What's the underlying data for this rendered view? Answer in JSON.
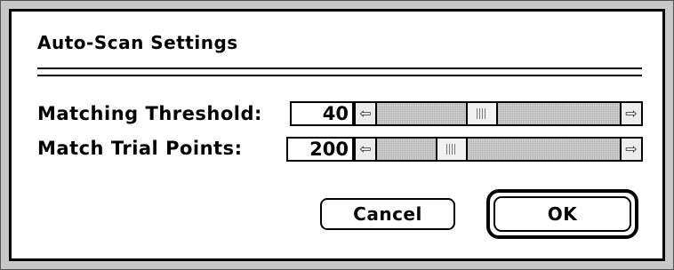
{
  "dialog": {
    "title": "Auto-Scan Settings"
  },
  "settings": [
    {
      "label": "Matching Threshold:",
      "value": "40",
      "slider_position_fraction": 0.42
    },
    {
      "label": "Match Trial Points:",
      "value": "200",
      "slider_position_fraction": 0.28
    }
  ],
  "buttons": {
    "cancel_label": "Cancel",
    "ok_label": "OK"
  },
  "icons": {
    "scroll_left": "left-arrow-icon",
    "scroll_right": "right-arrow-icon",
    "scroll_thumb": "scroll-thumb-grip-icon"
  },
  "colors": {
    "frame_band": "#c8c8c8",
    "scroll_track": "#d4d4d4",
    "text": "#000000",
    "background": "#ffffff"
  }
}
